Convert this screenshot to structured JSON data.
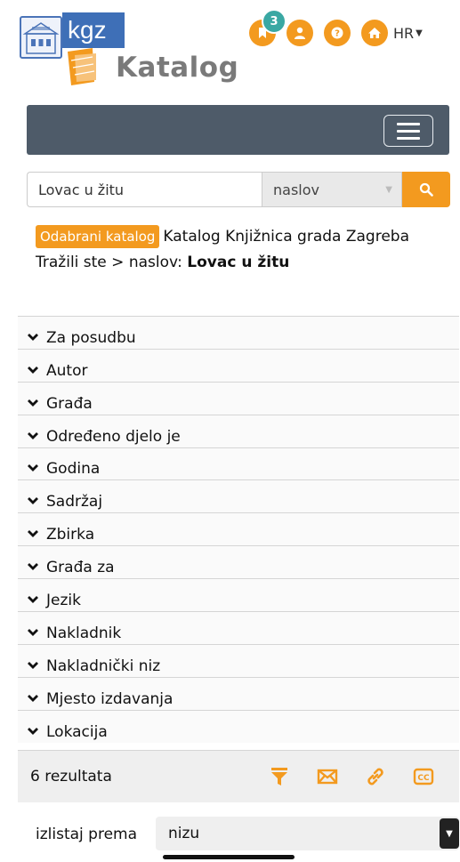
{
  "logo": {
    "short": "kgz",
    "name": "Katalog"
  },
  "header": {
    "bookmark_count": "3",
    "language": "HR"
  },
  "search": {
    "query_value": "Lovac u žitu",
    "field_selected": "naslov"
  },
  "info": {
    "catalog_tag": "Odabrani katalog",
    "catalog_name": "Katalog Knjižnica grada Zagreba",
    "searched_prefix": "Tražili ste > naslov:",
    "searched_query": "Lovac u žitu"
  },
  "facets": [
    {
      "label": "Za posudbu"
    },
    {
      "label": "Autor"
    },
    {
      "label": "Građa"
    },
    {
      "label": "Određeno djelo je"
    },
    {
      "label": "Godina"
    },
    {
      "label": "Sadržaj"
    },
    {
      "label": "Zbirka"
    },
    {
      "label": "Građa za"
    },
    {
      "label": "Jezik"
    },
    {
      "label": "Nakladnik"
    },
    {
      "label": "Nakladnički niz"
    },
    {
      "label": "Mjesto izdavanja"
    },
    {
      "label": "Lokacija"
    }
  ],
  "results": {
    "count_text": "6 rezultata",
    "tools": [
      "filter-icon",
      "envelope-icon",
      "link-icon",
      "cc-icon"
    ]
  },
  "sort": {
    "label": "izlistaj prema",
    "selected": "nizu"
  },
  "colors": {
    "accent": "#f39a1f",
    "navbar": "#4e5b69",
    "badge": "#3aa8a3",
    "logo_blue": "#3e6fb7"
  }
}
